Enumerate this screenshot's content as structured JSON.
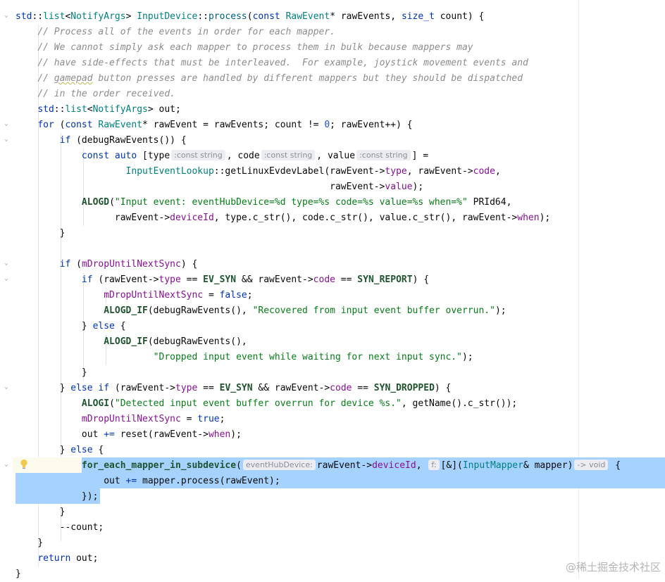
{
  "editor": {
    "lines": [
      "std::list<NotifyArgs> InputDevice::process(const RawEvent* rawEvents, size_t count) {",
      "    // Process all of the events in order for each mapper.",
      "    // We cannot simply ask each mapper to process them in bulk because mappers may",
      "    // have side-effects that must be interleaved.  For example, joystick movement events and",
      "    // gamepad button presses are handled by different mappers but they should be dispatched",
      "    // in the order received.",
      "    std::list<NotifyArgs> out;",
      "    for (const RawEvent* rawEvent = rawEvents; count != 0; rawEvent++) {",
      "        if (debugRawEvents()) {",
      "            const auto [type , code , value ] =",
      "                    InputEventLookup::getLinuxEvdevLabel(rawEvent->type, rawEvent->code,",
      "                                                         rawEvent->value);",
      "            ALOGD(\"Input event: eventHubDevice=%d type=%s code=%s value=%s when=%\" PRId64,",
      "                  rawEvent->deviceId, type.c_str(), code.c_str(), value.c_str(), rawEvent->when);",
      "        }",
      "",
      "        if (mDropUntilNextSync) {",
      "            if (rawEvent->type == EV_SYN && rawEvent->code == SYN_REPORT) {",
      "                mDropUntilNextSync = false;",
      "                ALOGD_IF(debugRawEvents(), \"Recovered from input event buffer overrun.\");",
      "            } else {",
      "                ALOGD_IF(debugRawEvents(),",
      "                         \"Dropped input event while waiting for next input sync.\");",
      "            }",
      "        } else if (rawEvent->type == EV_SYN && rawEvent->code == SYN_DROPPED) {",
      "            ALOGI(\"Detected input event buffer overrun for device %s.\", getName().c_str());",
      "            mDropUntilNextSync = true;",
      "            out += reset(rawEvent->when);",
      "        } else {",
      "            for_each_mapper_in_subdevice( rawEvent->deviceId,  [&](InputMapper& mapper)  {",
      "                out += mapper.process(rawEvent);",
      "            });",
      "        }",
      "        --count;",
      "    }",
      "    return out;",
      "}"
    ],
    "hints": {
      "type_hint": ":const string",
      "code_hint": ":const string",
      "value_hint": ":const string",
      "param_hint": "eventHubDevice:",
      "f_hint": "f:",
      "return_hint": "-> void"
    }
  },
  "watermark": "@稀土掘金技术社区",
  "colors": {
    "keyword": "#0033b3",
    "type": "#008080",
    "comment": "#8c8c8c",
    "string": "#067d17",
    "field": "#871094",
    "selection": "#a6d2ff"
  },
  "icons": [
    "chevron-fold-icon",
    "lightbulb-icon"
  ]
}
